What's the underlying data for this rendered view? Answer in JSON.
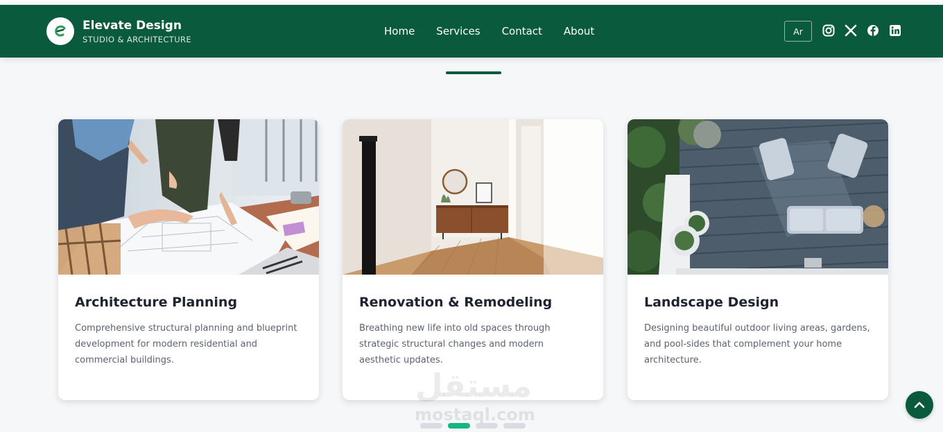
{
  "brand": {
    "title": "Elevate Design",
    "subtitle": "STUDIO & ARCHITECTURE",
    "logo_icon": "leaf-e-logo-icon",
    "accent": "#0a5a3d"
  },
  "nav": {
    "items": [
      {
        "label": "Home"
      },
      {
        "label": "Services"
      },
      {
        "label": "Contact"
      },
      {
        "label": "About"
      }
    ],
    "language_label": "Ar",
    "social_icons": [
      "instagram-icon",
      "x-icon",
      "facebook-icon",
      "linkedin-icon"
    ]
  },
  "services": {
    "cards": [
      {
        "title": "Architecture Planning",
        "description": "Comprehensive structural planning and blueprint development for modern residential and commercial buildings.",
        "image": "architects-blueprint-photo"
      },
      {
        "title": "Renovation & Remodeling",
        "description": "Breathing new life into old spaces through strategic structural changes and modern aesthetic updates.",
        "image": "renovated-interior-photo"
      },
      {
        "title": "Landscape Design",
        "description": "Designing beautiful outdoor living areas, gardens, and pool-sides that complement your home architecture.",
        "image": "outdoor-deck-garden-photo"
      }
    ]
  },
  "carousel": {
    "dot_count": 4,
    "active_index": 1,
    "active_color": "#16b582"
  },
  "watermark": {
    "arabic": "مستقل",
    "latin": "mostaql.com"
  },
  "scroll_top_icon": "chevron-up-icon"
}
